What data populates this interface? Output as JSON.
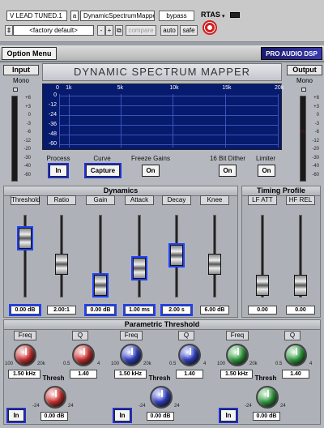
{
  "host": {
    "track": "V LEAD TUNED.1",
    "insert_letter": "a",
    "plugin": "DynamicSpectrumMapper",
    "bypass": "bypass",
    "format": "RTAS",
    "preset": "<factory default>",
    "minus": "-",
    "plus": "+",
    "compare": "compare",
    "auto": "auto",
    "safe": "safe"
  },
  "strip": {
    "option_menu": "Option Menu",
    "brand": "PRO AUDIO DSP"
  },
  "input": {
    "title": "Input",
    "mono": "Mono",
    "scale": [
      "+6",
      "+3",
      "0",
      "-3",
      "-6",
      "-12",
      "-20",
      "-30",
      "-40",
      "-60"
    ]
  },
  "output": {
    "title": "Output",
    "mono": "Mono",
    "scale": [
      "+6",
      "+3",
      "0",
      "-3",
      "-6",
      "-12",
      "-20",
      "-30",
      "-40",
      "-60"
    ]
  },
  "display": {
    "title": "DYNAMIC SPECTRUM MAPPER",
    "x_ticks": [
      "0",
      "1k",
      "5k",
      "10k",
      "15k",
      "20k"
    ],
    "y_ticks": [
      "0",
      "-12",
      "-24",
      "-36",
      "-48",
      "-60"
    ]
  },
  "controls": {
    "process_label": "Process",
    "process": "In",
    "curve_label": "Curve",
    "curve": "Capture",
    "freeze_label": "Freeze Gains",
    "freeze": "On",
    "dither_label": "16 Bit Dither",
    "dither": "On",
    "limiter_label": "Limiter",
    "limiter": "On"
  },
  "dynamics": {
    "title": "Dynamics",
    "params": [
      {
        "label": "Threshold",
        "value": "0.00 dB",
        "position": 0.78
      },
      {
        "label": "Ratio",
        "value": "2.00:1",
        "position": 0.35
      },
      {
        "label": "Gain",
        "value": "0.00 dB",
        "position": 0.0
      },
      {
        "label": "Attack",
        "value": "1.00 ms",
        "position": 0.28
      },
      {
        "label": "Decay",
        "value": "2.00 s",
        "position": 0.5
      },
      {
        "label": "Knee",
        "value": "6.00 dB",
        "position": 0.35
      }
    ]
  },
  "timing": {
    "title": "Timing Profile",
    "params": [
      {
        "label": "LF ATT",
        "value": "0.00",
        "position": 0.0
      },
      {
        "label": "HF REL",
        "value": "0.00",
        "position": 0.0
      }
    ]
  },
  "parametric": {
    "title": "Parametric Threshold",
    "bands": [
      {
        "freq_label": "Freq",
        "freq": "1.50 kHz",
        "freq_min": "100",
        "freq_max": "20k",
        "q_label": "Q",
        "q": "1.40",
        "q_min": "0.5",
        "q_max": "4",
        "thresh_label": "Thresh",
        "thresh": "0.00 dB",
        "thresh_min": "-24",
        "thresh_max": "24",
        "in": "In",
        "color": "#d03030"
      },
      {
        "freq_label": "Freq",
        "freq": "1.50 kHz",
        "freq_min": "100",
        "freq_max": "20k",
        "q_label": "Q",
        "q": "1.40",
        "q_min": "0.5",
        "q_max": "4",
        "thresh_label": "Thresh",
        "thresh": "0.00 dB",
        "thresh_min": "-24",
        "thresh_max": "24",
        "in": "In",
        "color": "#3040c8"
      },
      {
        "freq_label": "Freq",
        "freq": "1.50 kHz",
        "freq_min": "100",
        "freq_max": "20k",
        "q_label": "Q",
        "q": "1.40",
        "q_min": "0.5",
        "q_max": "4",
        "thresh_label": "Thresh",
        "thresh": "0.00 dB",
        "thresh_min": "-24",
        "thresh_max": "24",
        "in": "In",
        "color": "#30a040"
      }
    ]
  }
}
